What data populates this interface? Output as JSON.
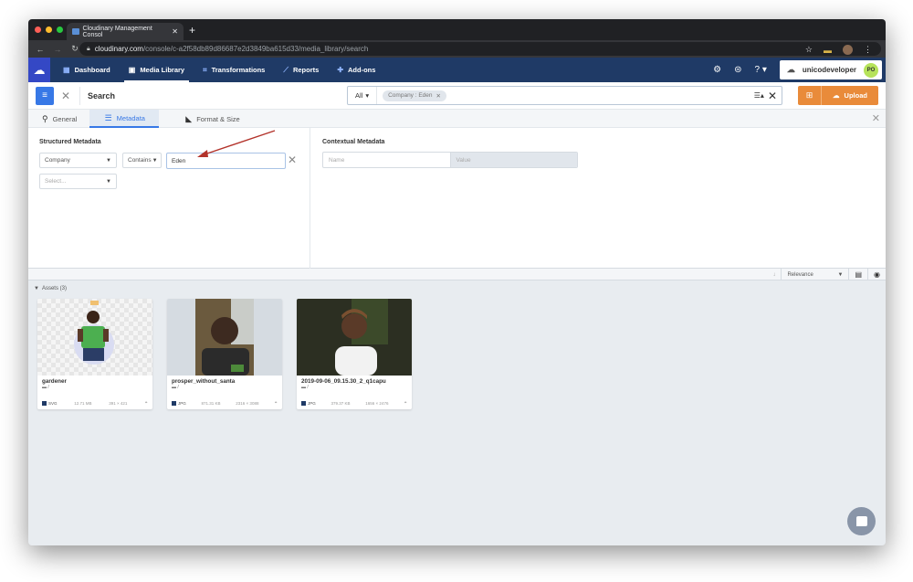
{
  "browser": {
    "tab_title": "Cloudinary Management Consol",
    "url_host": "cloudinary.com",
    "url_path": "/console/c-a2f58db89d86687e2d3849ba615d33/media_library/search"
  },
  "app": {
    "nav": [
      {
        "label": "Dashboard",
        "icon": "grid-icon"
      },
      {
        "label": "Media Library",
        "icon": "media-icon",
        "active": true
      },
      {
        "label": "Transformations",
        "icon": "transform-icon"
      },
      {
        "label": "Reports",
        "icon": "chart-icon"
      },
      {
        "label": "Add-ons",
        "icon": "puzzle-icon"
      }
    ],
    "user": {
      "name": "unicodeveloper",
      "initials": "PO"
    }
  },
  "search": {
    "label": "Search",
    "scope": "All",
    "chip": "Company : Eden",
    "upload_label": "Upload"
  },
  "filter_tabs": [
    {
      "label": "General"
    },
    {
      "label": "Metadata",
      "active": true
    },
    {
      "label": "Format & Size"
    }
  ],
  "structured": {
    "title": "Structured Metadata",
    "field": "Company",
    "operator": "Contains",
    "value": "Eden",
    "next_placeholder": "Select..."
  },
  "contextual": {
    "title": "Contextual Metadata",
    "name_placeholder": "Name",
    "value_placeholder": "Value"
  },
  "results": {
    "sort": "Relevance",
    "assets_label": "Assets (3)"
  },
  "assets": [
    {
      "name": "gardener",
      "folder": "/",
      "format": "SVG",
      "size": "12.71 MB",
      "dims": "391 × 421"
    },
    {
      "name": "prosper_without_santa",
      "folder": "/",
      "format": "JPG",
      "size": "871.31 KB",
      "dims": "2316 × 3088"
    },
    {
      "name": "2019-09-06_09.15.30_2_q1capu",
      "folder": "/",
      "format": "JPG",
      "size": "379.37 KB",
      "dims": "1656 × 2476"
    }
  ],
  "colors": {
    "brand": "#1f3a66",
    "accent": "#3778e6",
    "upload": "#e98b3a"
  }
}
